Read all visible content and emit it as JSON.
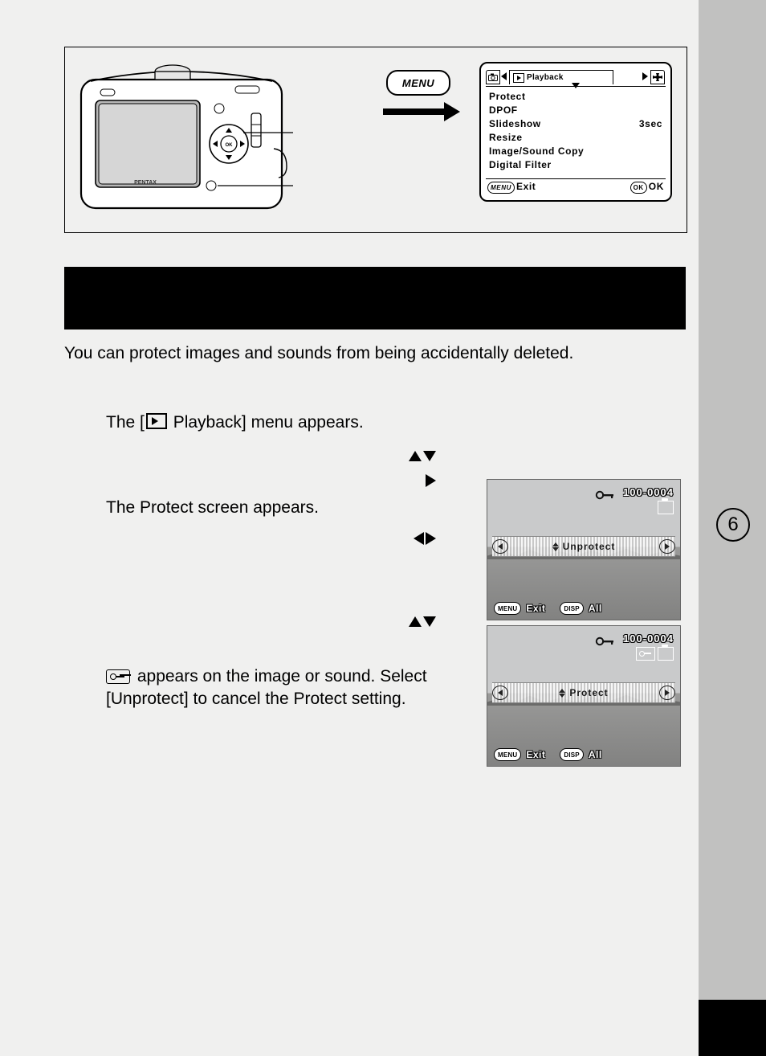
{
  "page": {
    "number": "6"
  },
  "topPanel": {
    "menuPill": "MENU",
    "lcd": {
      "activeTabLabel": "Playback",
      "items": [
        {
          "label": "Protect",
          "value": ""
        },
        {
          "label": "DPOF",
          "value": ""
        },
        {
          "label": "Slideshow",
          "value": "3sec"
        },
        {
          "label": "Resize",
          "value": ""
        },
        {
          "label": "Image/Sound Copy",
          "value": ""
        },
        {
          "label": "Digital Filter",
          "value": ""
        }
      ],
      "footerLeftPill": "MENU",
      "footerLeftText": "Exit",
      "footerRightPill": "OK",
      "footerRightText": "OK"
    }
  },
  "body": {
    "intro": "You can protect images and sounds from being accidentally deleted.",
    "line1a": "The [",
    "line1b": " Playback] menu appears.",
    "line2": "The Protect screen appears.",
    "line3a": " appears on the image or sound. Select [Unprotect] to cancel the Protect setting."
  },
  "shot1": {
    "counter": "100-0004",
    "bandLabel": "Unprotect",
    "footMenuPill": "MENU",
    "footMenuText": "Exit",
    "footDispPill": "DISP",
    "footDispText": "All"
  },
  "shot2": {
    "counter": "100-0004",
    "bandLabel": "Protect",
    "footMenuPill": "MENU",
    "footMenuText": "Exit",
    "footDispPill": "DISP",
    "footDispText": "All"
  }
}
